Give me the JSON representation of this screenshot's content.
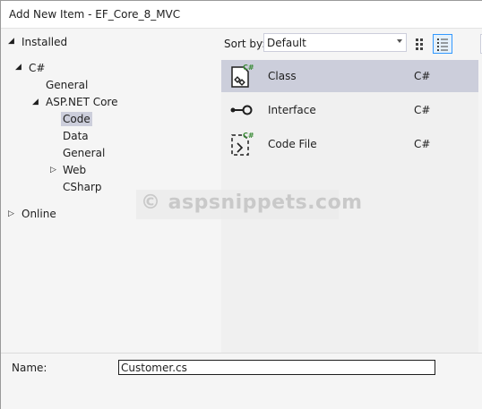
{
  "window": {
    "title": "Add New Item - EF_Core_8_MVC"
  },
  "tree": {
    "installed": "Installed",
    "csharp": "C#",
    "general_1": "General",
    "aspnet": "ASP.NET Core",
    "code": "Code",
    "data": "Data",
    "general_2": "General",
    "web": "Web",
    "csharp_sub": "CSharp",
    "online": "Online"
  },
  "sort": {
    "label": "Sort by:",
    "value": "Default"
  },
  "templates": [
    {
      "name": "Class",
      "lang": "C#",
      "icon": "class-icon",
      "selected": true
    },
    {
      "name": "Interface",
      "lang": "C#",
      "icon": "interface-icon",
      "selected": false
    },
    {
      "name": "Code File",
      "lang": "C#",
      "icon": "code-file-icon",
      "selected": false
    }
  ],
  "watermark": "© aspsnippets.com",
  "name_field": {
    "label": "Name:",
    "value": "Customer.cs"
  },
  "colors": {
    "selection": "#cccedb",
    "csharp_badge": "#388a34",
    "active_view_border": "#3399ff"
  }
}
